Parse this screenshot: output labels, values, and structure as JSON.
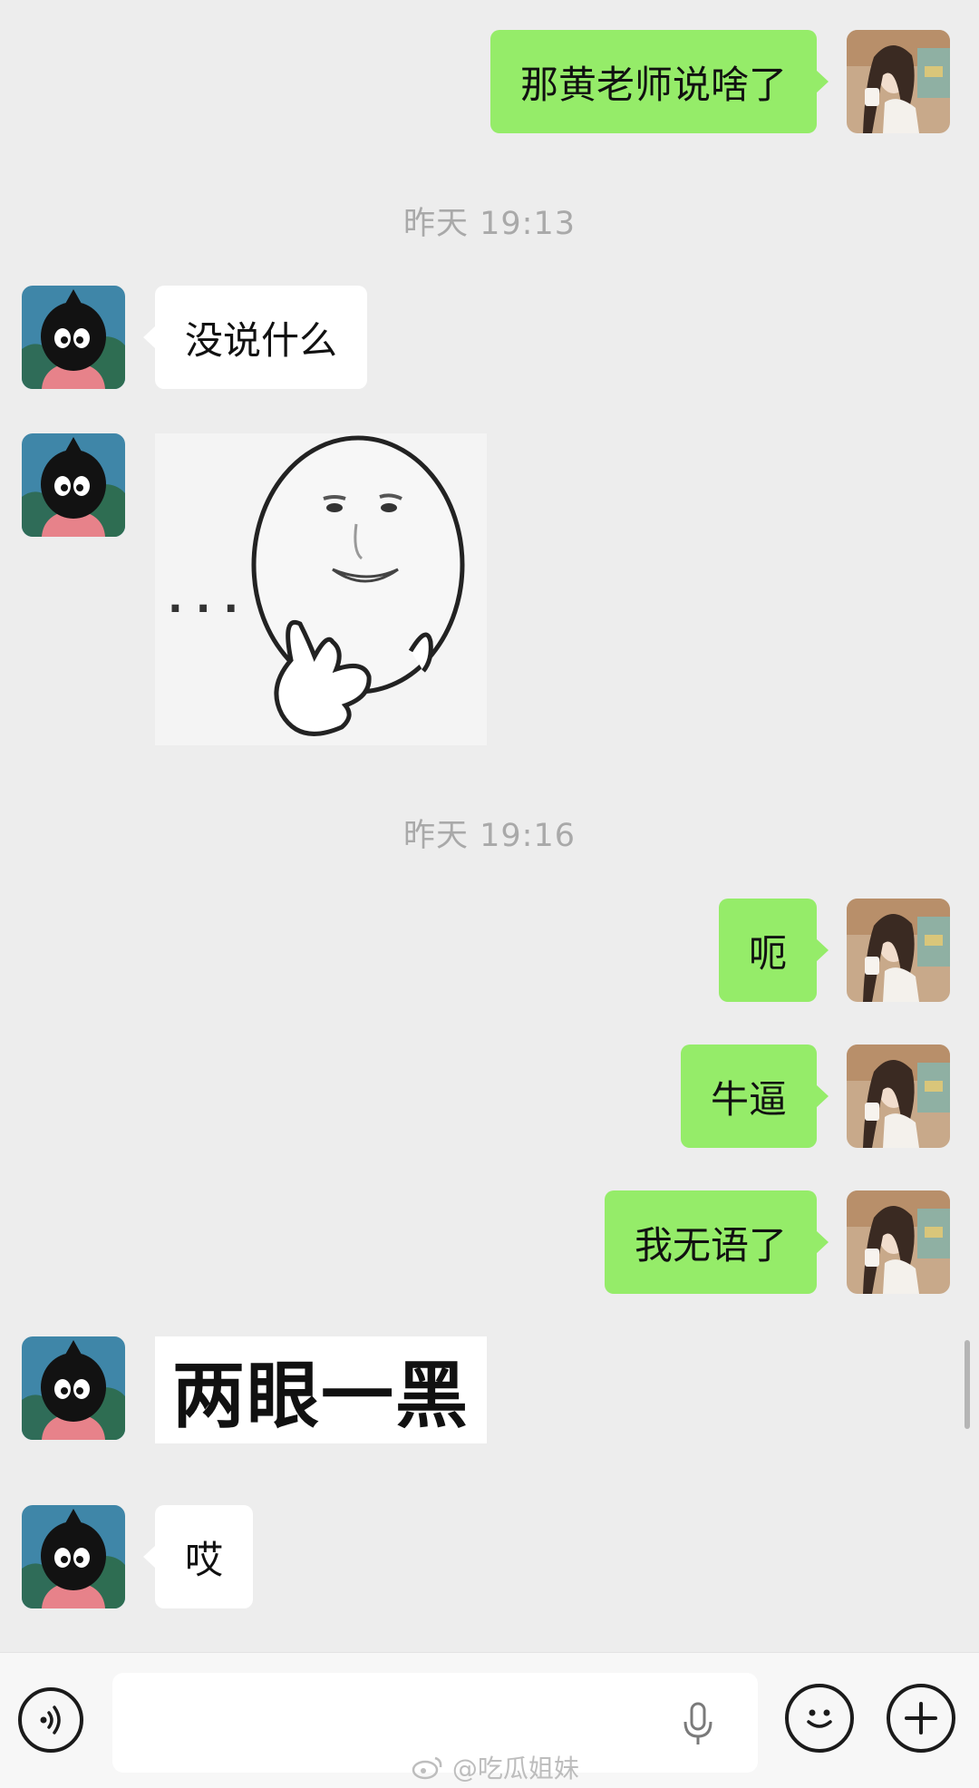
{
  "app": "WeChat",
  "messages": [
    {
      "side": "mine",
      "text": "那黄老师说啥了"
    },
    {
      "time": "昨天 19:13"
    },
    {
      "side": "theirs",
      "text": "没说什么"
    },
    {
      "side": "theirs",
      "sticker": "thinking-face-sticker",
      "sticker_caption": "···"
    },
    {
      "time": "昨天 19:16"
    },
    {
      "side": "mine",
      "text": "呃"
    },
    {
      "side": "mine",
      "text": "牛逼"
    },
    {
      "side": "mine",
      "text": "我无语了"
    },
    {
      "side": "theirs",
      "sticker": "text-sticker",
      "sticker_text": "两眼一黑"
    },
    {
      "side": "theirs",
      "text": "哎"
    }
  ],
  "input_bar": {
    "voice_icon": "voice-wave-icon",
    "mic_icon": "microphone-icon",
    "emoji_icon": "emoji-face-icon",
    "more_icon": "plus-icon"
  },
  "watermark": {
    "text": "@吃瓜姐妹",
    "icon": "weibo-logo"
  },
  "colors": {
    "background": "#ededed",
    "my_bubble": "#95ec69",
    "their_bubble": "#ffffff",
    "timestamp_text": "#a9a9a9"
  }
}
